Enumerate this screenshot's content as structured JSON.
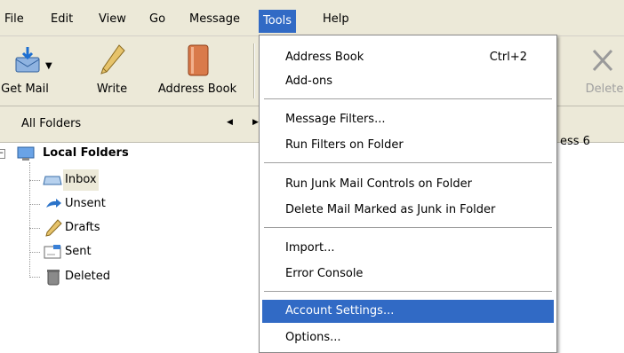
{
  "menubar": {
    "items": [
      {
        "label": "File"
      },
      {
        "label": "Edit"
      },
      {
        "label": "View"
      },
      {
        "label": "Go"
      },
      {
        "label": "Message"
      },
      {
        "label": "Tools"
      },
      {
        "label": "Help"
      }
    ]
  },
  "toolbar": {
    "get_mail": "Get Mail",
    "write": "Write",
    "address_book": "Address Book",
    "delete": "Delete"
  },
  "folder_pane": {
    "header": "All Folders",
    "root": "Local Folders",
    "folders": [
      "Inbox",
      "Unsent",
      "Drafts",
      "Sent",
      "Deleted"
    ]
  },
  "right_pane_text": "ess 6",
  "tools_menu": {
    "items": [
      {
        "label": "Address Book",
        "shortcut": "Ctrl+2"
      },
      {
        "label": "Add-ons"
      },
      {
        "label": "Message Filters..."
      },
      {
        "label": "Run Filters on Folder"
      },
      {
        "label": "Run Junk Mail Controls on Folder"
      },
      {
        "label": "Delete Mail Marked as Junk in Folder"
      },
      {
        "label": "Import..."
      },
      {
        "label": "Error Console"
      },
      {
        "label": "Account Settings..."
      },
      {
        "label": "Options..."
      }
    ],
    "highlighted": "Account Settings..."
  },
  "colors": {
    "chrome": "#ece9d8",
    "highlight": "#316ac5"
  }
}
